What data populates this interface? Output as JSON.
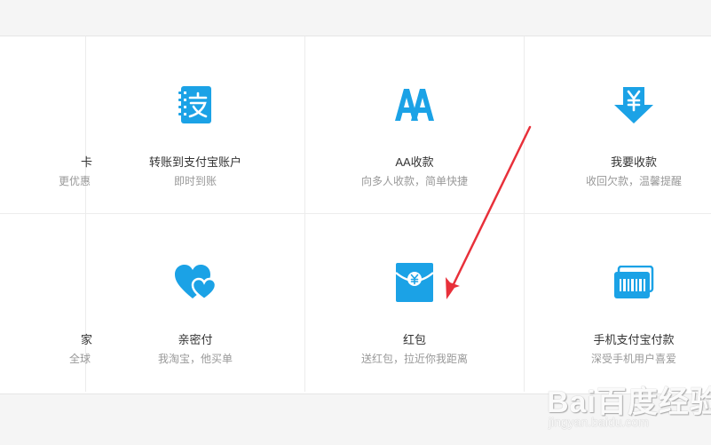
{
  "colors": {
    "icon_blue": "#1ba2e6",
    "arrow_red": "#e8303a",
    "title_text": "#333333",
    "sub_text": "#999999"
  },
  "tiles": [
    {
      "title": "卡",
      "sub": "更优惠",
      "icon": "card-icon"
    },
    {
      "title": "转账到支付宝账户",
      "sub": "即时到账",
      "icon": "alipay-transfer-icon"
    },
    {
      "title": "AA收款",
      "sub": "向多人收款，简单快捷",
      "icon": "aa-icon"
    },
    {
      "title": "我要收款",
      "sub": "收回欠款，温馨提醒",
      "icon": "yuan-down-arrow-icon"
    },
    {
      "title": "家",
      "sub": "全球",
      "icon": "global-icon"
    },
    {
      "title": "亲密付",
      "sub": "我淘宝，他买单",
      "icon": "hearts-icon"
    },
    {
      "title": "红包",
      "sub": "送红包，拉近你我距离",
      "icon": "red-envelope-icon"
    },
    {
      "title": "手机支付宝付款",
      "sub": "深受手机用户喜爱",
      "icon": "barcode-card-icon"
    }
  ],
  "watermark": {
    "logo": "Bai百度经验",
    "url": "jingyan.baidu.com"
  }
}
